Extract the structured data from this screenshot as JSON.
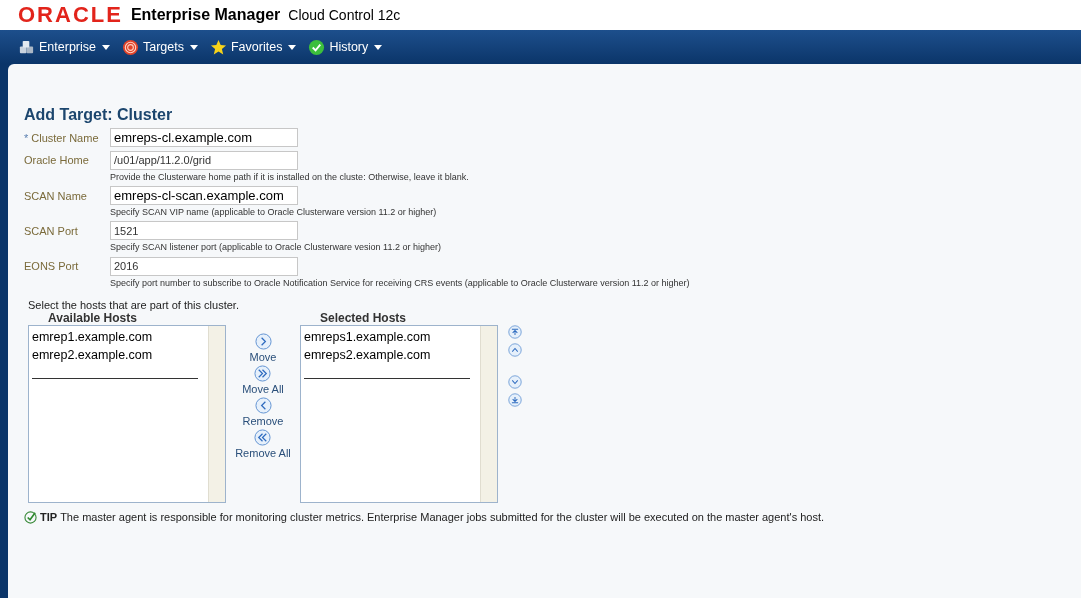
{
  "header": {
    "logo": "ORACLE",
    "product": "Enterprise Manager",
    "edition": "Cloud Control 12c"
  },
  "menus": [
    {
      "label": "Enterprise"
    },
    {
      "label": "Targets"
    },
    {
      "label": "Favorites"
    },
    {
      "label": "History"
    }
  ],
  "page_title": "Add Target: Cluster",
  "fields": [
    {
      "label": "Cluster Name",
      "marker": "*",
      "value": "emreps-cl.example.com",
      "large": true
    },
    {
      "label": "Oracle Home",
      "value": "/u01/app/11.2.0/grid",
      "large": false,
      "hint": "Provide the Clusterware home path if it is installed on the cluste: Otherwise, leave it blank."
    },
    {
      "label": "SCAN Name",
      "value": "emreps-cl-scan.example.com",
      "large": true,
      "hint": "Specify SCAN VIP name (applicable to Oracle Clusterware version 11.2 or higher)"
    },
    {
      "label": "SCAN Port",
      "value": "1521",
      "large": false,
      "hint": "Specify SCAN listener port (applicable to Oracle Clusterware vesion 11.2 or higher)"
    },
    {
      "label": "EONS Port",
      "value": "2016",
      "large": false,
      "hint": "Specify port number to subscribe to Oracle Notification Service for receiving CRS events (applicable to Oracle Clusterware version 11.2 or higher)"
    }
  ],
  "hosts_intro": "Select the hosts that are part of this cluster.",
  "available": {
    "title": "Available Hosts",
    "items": [
      "emrep1.example.com",
      "emrep2.example.com"
    ]
  },
  "shuttle": [
    {
      "label": "Move",
      "kind": "move"
    },
    {
      "label": "Move All",
      "kind": "move_all"
    },
    {
      "label": "Remove",
      "kind": "remove"
    },
    {
      "label": "Remove All",
      "kind": "remove_all"
    }
  ],
  "selected": {
    "title": "Selected Hosts",
    "items": [
      "emreps1.example.com",
      "emreps2.example.com"
    ]
  },
  "tip": {
    "label": "TIP",
    "text": "The master agent is responsible for monitoring cluster metrics. Enterprise Manager jobs submitted for the cluster will be executed on the master agent's host."
  }
}
